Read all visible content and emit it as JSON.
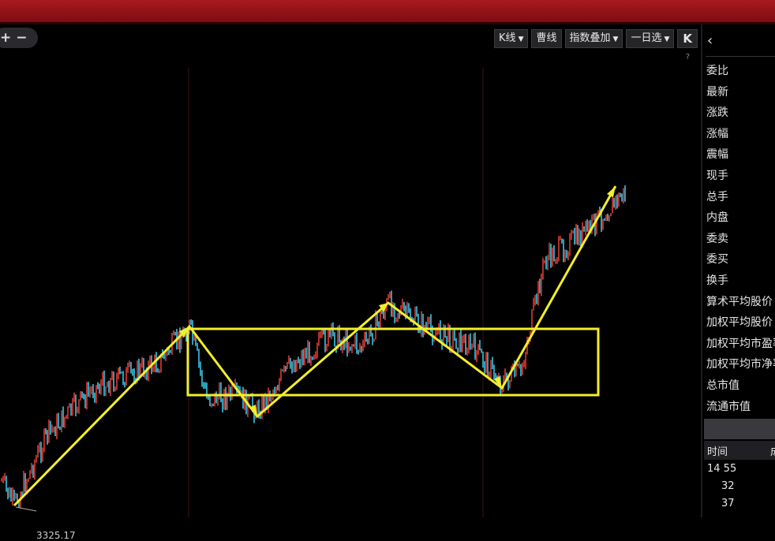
{
  "toolbar": {
    "zoom_in": "+",
    "zoom_out": "−",
    "kline_label": "K线",
    "line2_label": "曹线",
    "indicator_label": "指数叠加",
    "period_label": "一日选",
    "expand_label": "K",
    "hint": "?"
  },
  "chart": {
    "low_label": "3325.17",
    "colors": {
      "up": "#e03a33",
      "down": "#36c6e6",
      "annotation": "#f4ee2a",
      "background": "#000000"
    }
  },
  "sidebar": {
    "fields": [
      "委比",
      "最新",
      "涨跌",
      "涨幅",
      "震幅",
      "现手",
      "总手",
      "内盘",
      "委卖",
      "委买",
      "换手",
      "算术平均股价",
      "加权平均股价",
      "加权平均市盈率",
      "加权平均市净率",
      "总市值",
      "流通市值"
    ],
    "table_header": {
      "time": "时间",
      "second": "成"
    },
    "rows": [
      "14 55",
      "32",
      "37"
    ]
  }
}
